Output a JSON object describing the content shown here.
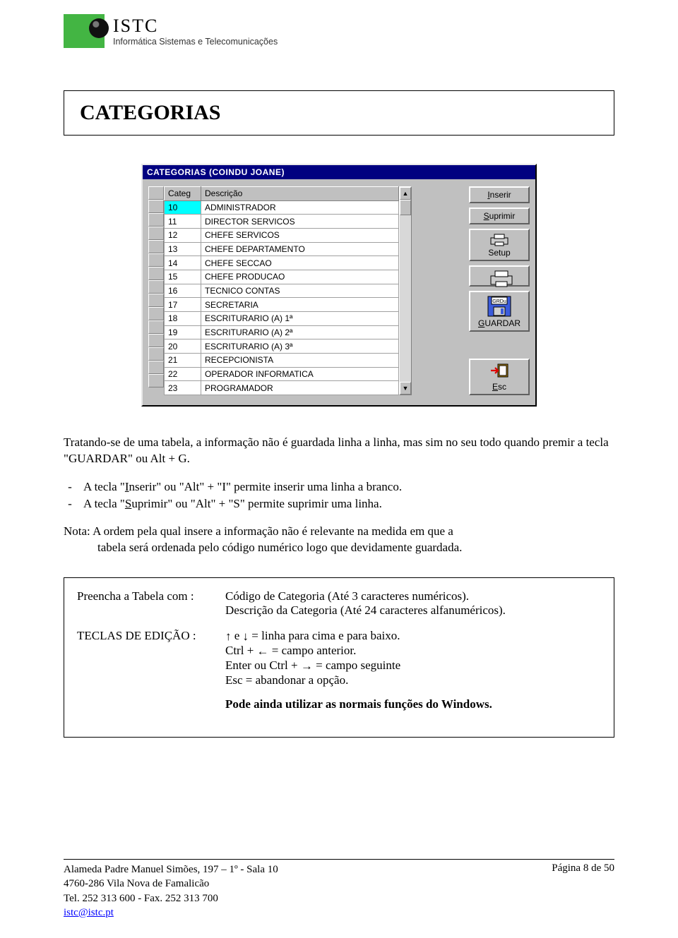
{
  "header": {
    "brand": "ISTC",
    "tagline": "Informática Sistemas e Telecomunicações"
  },
  "title": "CATEGORIAS",
  "dialog": {
    "title": "CATEGORIAS (COINDU JOANE)",
    "columns": {
      "categ": "Categ",
      "desc": "Descrição"
    },
    "rows": [
      {
        "categ": "10",
        "desc": "ADMINISTRADOR",
        "selected": true
      },
      {
        "categ": "11",
        "desc": "DIRECTOR SERVICOS"
      },
      {
        "categ": "12",
        "desc": "CHEFE SERVICOS"
      },
      {
        "categ": "13",
        "desc": "CHEFE DEPARTAMENTO"
      },
      {
        "categ": "14",
        "desc": "CHEFE SECCAO"
      },
      {
        "categ": "15",
        "desc": "CHEFE PRODUCAO"
      },
      {
        "categ": "16",
        "desc": "TECNICO CONTAS"
      },
      {
        "categ": "17",
        "desc": "SECRETARIA"
      },
      {
        "categ": "18",
        "desc": "ESCRITURARIO (A) 1ª"
      },
      {
        "categ": "19",
        "desc": "ESCRITURARIO (A) 2ª"
      },
      {
        "categ": "20",
        "desc": "ESCRITURARIO (A) 3ª"
      },
      {
        "categ": "21",
        "desc": "RECEPCIONISTA"
      },
      {
        "categ": "22",
        "desc": "OPERADOR INFORMATICA"
      },
      {
        "categ": "23",
        "desc": "PROGRAMADOR"
      }
    ],
    "buttons": {
      "inserir": "Inserir",
      "suprimir": "Suprimir",
      "setup": "Setup",
      "guardar": "GUARDAR",
      "guardar_badge": "GRDu",
      "esc": "Esc"
    }
  },
  "body": {
    "p1": "Tratando-se de uma tabela, a informação não é guardada linha a linha, mas sim no seu todo quando premir a tecla \"GUARDAR\" ou Alt + G.",
    "b1_pre": "A tecla \"",
    "b1_u": "I",
    "b1_post": "nserir\" ou \"Alt\" + \"I\" permite inserir uma linha a branco.",
    "b2_pre": "A tecla \"",
    "b2_u": "S",
    "b2_post": "uprimir\" ou \"Alt\" + \"S\" permite suprimir uma linha.",
    "note_label": "Nota:",
    "note_line1": "A ordem pela qual insere a informação não é relevante na medida em que a",
    "note_line2": "tabela será ordenada pelo código numérico logo que devidamente guardada."
  },
  "box": {
    "k1": "Preencha a Tabela com :",
    "v1a": "Código de Categoria (Até 3 caracteres numéricos).",
    "v1b": "Descrição da Categoria (Até 24 caracteres alfanuméricos).",
    "k2": "TECLAS DE EDIÇÃO :",
    "v2a_mid": "  e  ",
    "v2a_post": "  =  linha para cima e para baixo.",
    "v2b_pre": "Ctrl + ",
    "v2b_post": "    = campo anterior.",
    "v2c_pre": "Enter ou Ctrl + ",
    "v2c_post": "    = campo seguinte",
    "v2d": "Esc = abandonar a opção.",
    "v3": "Pode ainda utilizar as normais funções do Windows."
  },
  "footer": {
    "line1": "Alameda Padre Manuel Simões, 197 – 1º - Sala 10",
    "line2": "4760-286 Vila Nova de Famalicão",
    "line3": "Tel. 252 313 600  -  Fax. 252 313 700",
    "email": "istc@istc.pt",
    "page": "Página 8 de 50"
  }
}
